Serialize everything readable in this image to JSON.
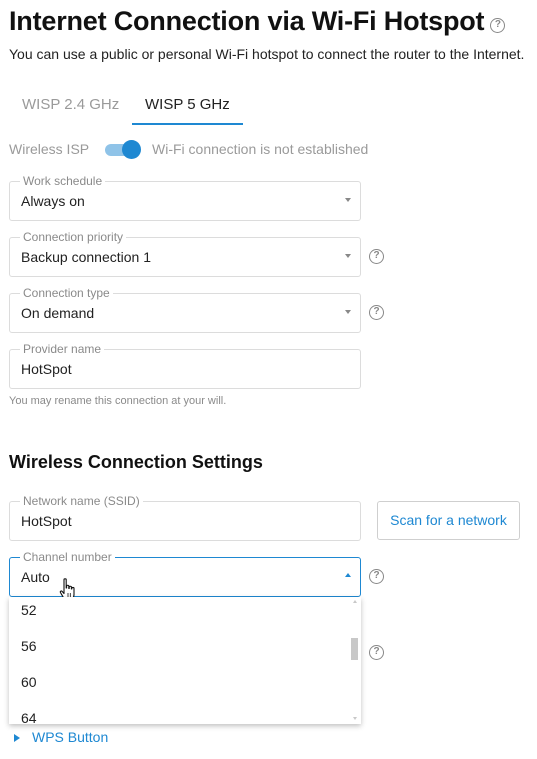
{
  "page": {
    "title": "Internet Connection via Wi-Fi Hotspot",
    "description": "You can use a public or personal Wi-Fi hotspot to connect the router to the Internet."
  },
  "tabs": [
    {
      "label": "WISP 2.4 GHz",
      "active": false
    },
    {
      "label": "WISP 5 GHz",
      "active": true
    }
  ],
  "wireless_isp": {
    "label": "Wireless ISP",
    "enabled": true,
    "status": "Wi-Fi connection is not established"
  },
  "fields": {
    "work_schedule": {
      "label": "Work schedule",
      "value": "Always on"
    },
    "connection_priority": {
      "label": "Connection priority",
      "value": "Backup connection 1"
    },
    "connection_type": {
      "label": "Connection type",
      "value": "On demand"
    },
    "provider_name": {
      "label": "Provider name",
      "value": "HotSpot"
    }
  },
  "provider_hint": "You may rename this connection at your will.",
  "wireless_settings": {
    "title": "Wireless Connection Settings",
    "ssid": {
      "label": "Network name (SSID)",
      "value": "HotSpot"
    },
    "scan_button": "Scan for a network",
    "channel": {
      "label": "Channel number",
      "value": "Auto",
      "options_visible": [
        "52",
        "56",
        "60",
        "64"
      ]
    }
  },
  "wps_link": "WPS Button",
  "icons": {
    "help": "question-circle-icon",
    "dropdown": "chevron-down-icon",
    "cursor": "hand-pointer-icon",
    "expand": "triangle-right-icon"
  },
  "colors": {
    "accent": "#1e88d2",
    "toggle_track": "#8fc3e8",
    "muted_text": "#9a9a9a"
  }
}
